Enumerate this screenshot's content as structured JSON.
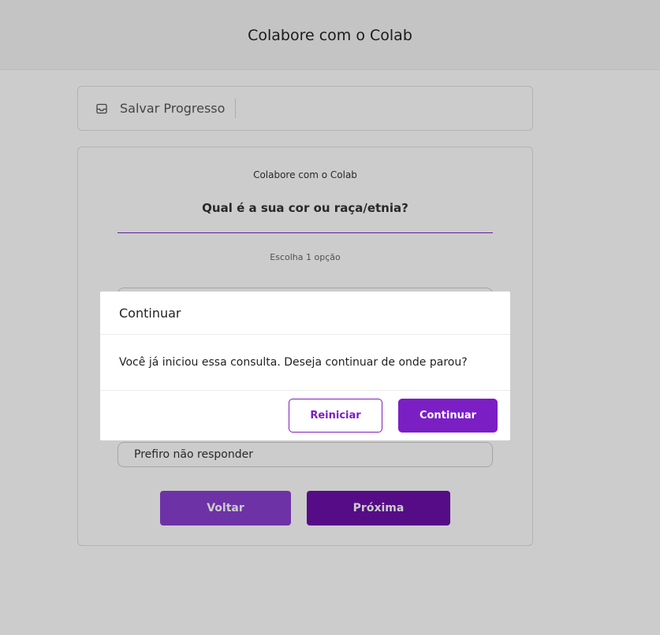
{
  "header": {
    "title": "Colabore com o Colab"
  },
  "save_bar": {
    "label": "Salvar Progresso",
    "icon": "inbox-icon"
  },
  "card": {
    "kicker": "Colabore com o Colab",
    "question": "Qual é a sua cor ou raça/etnia?",
    "hint": "Escolha 1 opção",
    "visible_option": "Prefiro não responder",
    "back_label": "Voltar",
    "next_label": "Próxima"
  },
  "modal": {
    "title": "Continuar",
    "message": "Você já iniciou essa consulta. Deseja continuar de onde parou?",
    "restart_label": "Reiniciar",
    "continue_label": "Continuar"
  },
  "colors": {
    "accent": "#7b1fc4",
    "accent_dark": "#6c10a8",
    "accent_light": "#8a3fd1"
  }
}
